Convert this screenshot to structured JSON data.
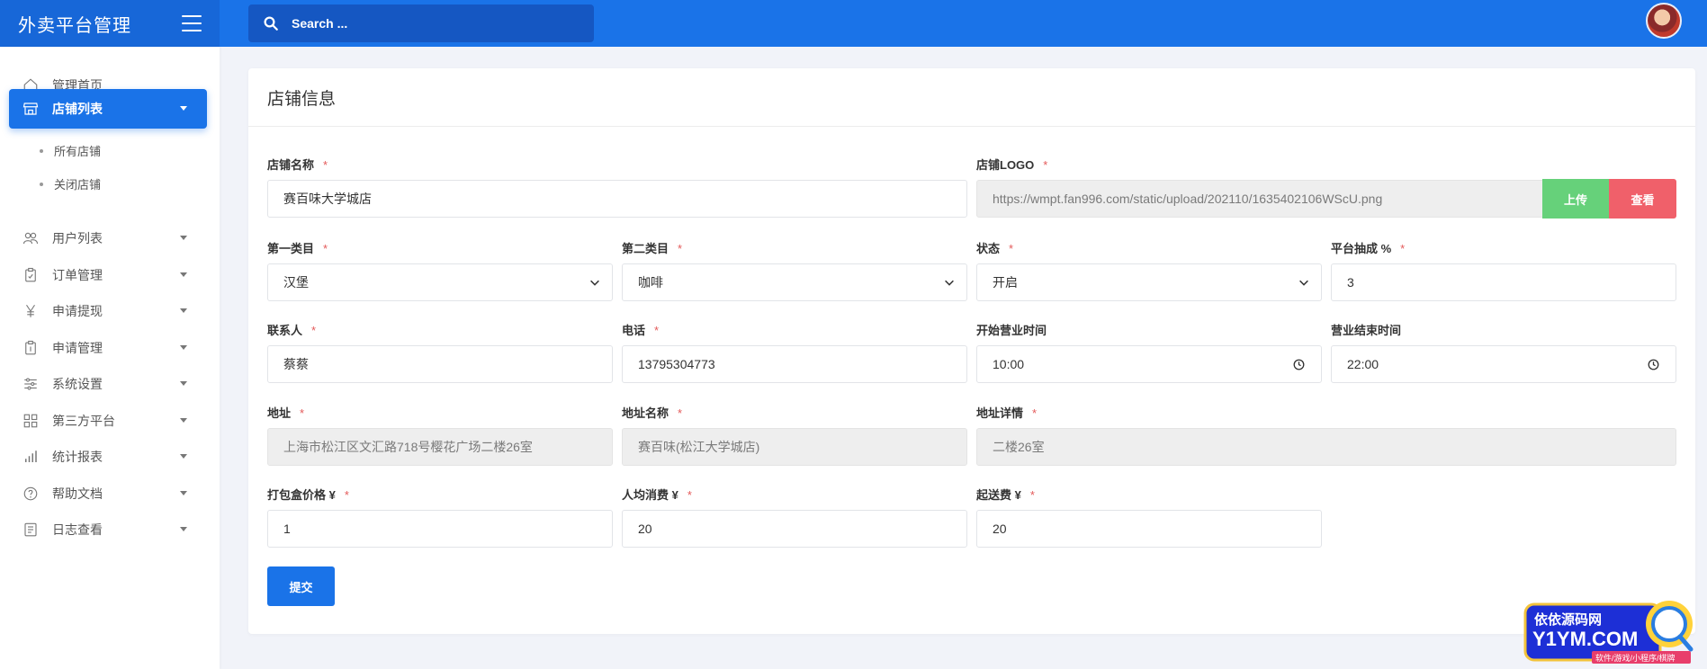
{
  "app": {
    "title": "外卖平台管理"
  },
  "search": {
    "placeholder": "Search ..."
  },
  "sidebar": {
    "items": [
      {
        "label": "管理首页",
        "icon": "home-icon"
      },
      {
        "label": "店铺列表",
        "icon": "store-icon",
        "active": true
      },
      {
        "label": "用户列表",
        "icon": "users-icon"
      },
      {
        "label": "订单管理",
        "icon": "clipboard-icon"
      },
      {
        "label": "申请提现",
        "icon": "yen-icon"
      },
      {
        "label": "申请管理",
        "icon": "clipboard-check-icon"
      },
      {
        "label": "系统设置",
        "icon": "sliders-icon"
      },
      {
        "label": "第三方平台",
        "icon": "grid-icon"
      },
      {
        "label": "统计报表",
        "icon": "bar-chart-icon"
      },
      {
        "label": "帮助文档",
        "icon": "help-icon"
      },
      {
        "label": "日志查看",
        "icon": "log-icon"
      }
    ],
    "subitems": [
      {
        "label": "所有店铺"
      },
      {
        "label": "关闭店铺"
      }
    ]
  },
  "card": {
    "title": "店铺信息",
    "fields": {
      "store_name": {
        "label": "店铺名称",
        "value": "赛百味大学城店"
      },
      "logo": {
        "label": "店铺LOGO",
        "value": "https://wmpt.fan996.com/static/upload/202110/1635402106WScU.png"
      },
      "category1": {
        "label": "第一类目",
        "value": "汉堡"
      },
      "category2": {
        "label": "第二类目",
        "value": "咖啡"
      },
      "status": {
        "label": "状态",
        "value": "开启"
      },
      "commission": {
        "label": "平台抽成 %",
        "value": "3"
      },
      "contact": {
        "label": "联系人",
        "value": "蔡蔡"
      },
      "phone": {
        "label": "电话",
        "value": "13795304773"
      },
      "open_time": {
        "label": "开始营业时间",
        "value": "10:00"
      },
      "close_time": {
        "label": "营业结束时间",
        "value": "22:00"
      },
      "address": {
        "label": "地址",
        "value": "上海市松江区文汇路718号樱花广场二楼26室"
      },
      "address_name": {
        "label": "地址名称",
        "value": "赛百味(松江大学城店)"
      },
      "address_detail": {
        "label": "地址详情",
        "value": "二楼26室"
      },
      "box_price": {
        "label": "打包盒价格 ¥",
        "value": "1"
      },
      "avg_spend": {
        "label": "人均消费 ¥",
        "value": "20"
      },
      "min_delivery": {
        "label": "起送费 ¥",
        "value": "20"
      }
    },
    "required_mark": "*",
    "buttons": {
      "upload": "上传",
      "view": "查看",
      "submit": "提交"
    }
  },
  "watermark": {
    "line1": "依依源码网",
    "line2": "Y1YM.COM",
    "line3": "软件/游戏/小程序/棋牌"
  },
  "colors": {
    "primary": "#1a73e8",
    "success": "#66d17a",
    "danger": "#f0606a"
  }
}
